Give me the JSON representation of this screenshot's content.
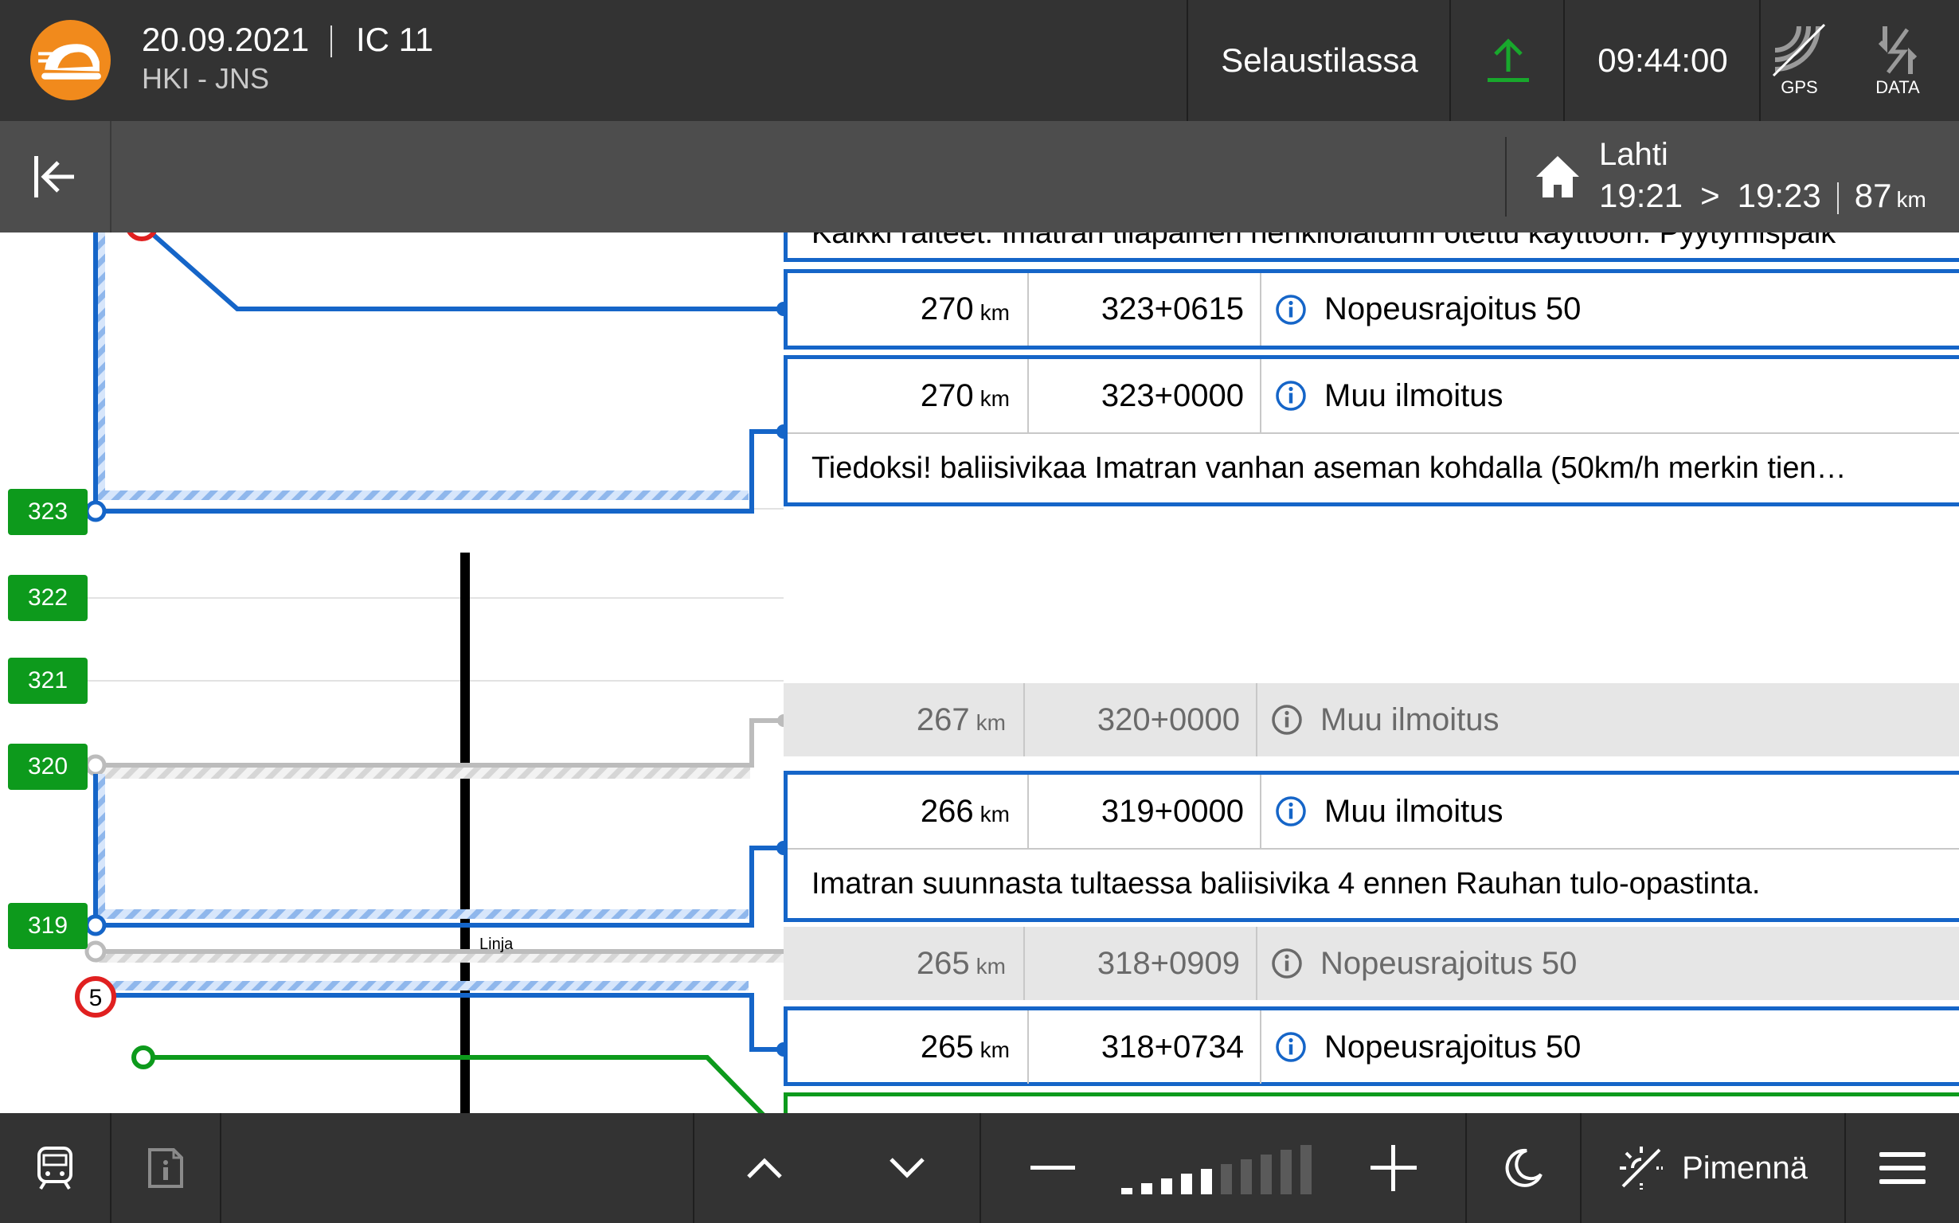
{
  "header": {
    "date": "20.09.2021",
    "train": "IC 11",
    "route": "HKI - JNS",
    "mode": "Selaustilassa",
    "clock": "09:44:00",
    "gps_label": "GPS",
    "data_label": "DATA",
    "upload_icon": "upload-arrow-icon",
    "colors": {
      "bar": "#333333",
      "upload": "#18a82c",
      "logo": "#f18a1c"
    }
  },
  "subheader": {
    "destination": "Lahti",
    "scheduled_time": "19:21",
    "arrow": ">",
    "estimated_time": "19:23",
    "distance": "87",
    "distance_unit": "km"
  },
  "track": {
    "badges": [
      "323",
      "322",
      "321",
      "320",
      "319"
    ],
    "speed_sign": "5",
    "linia_label": "Linja",
    "colors": {
      "active": "#1565c8",
      "inactive": "#bcbcbc",
      "green": "#0d9a1c",
      "speed_ring": "#e02020"
    }
  },
  "notices": {
    "top_partial_text": "Kaikki raiteet: Imatran tilapäinen henkilölaiturin otettu käyttöön. Pyytymispaik",
    "items": [
      {
        "km": "270",
        "unit": "km",
        "position": "323+0615",
        "title": "Nopeusrajoitus 50",
        "active": true
      },
      {
        "km": "270",
        "unit": "km",
        "position": "323+0000",
        "title": "Muu ilmoitus",
        "description": "Tiedoksi! baliisivikaa Imatran vanhan aseman kohdalla (50km/h merkin tien…",
        "active": true
      },
      {
        "km": "267",
        "unit": "km",
        "position": "320+0000",
        "title": "Muu ilmoitus",
        "active": false
      },
      {
        "km": "266",
        "unit": "km",
        "position": "319+0000",
        "title": "Muu ilmoitus",
        "description": "Imatran suunnasta tultaessa baliisivika 4 ennen Rauhan tulo-opastinta.",
        "active": true
      },
      {
        "km": "265",
        "unit": "km",
        "position": "318+0909",
        "title": "Nopeusrajoitus 50",
        "active": false
      },
      {
        "km": "265",
        "unit": "km",
        "position": "318+0734",
        "title": "Nopeusrajoitus 50",
        "active": true
      }
    ]
  },
  "footer": {
    "dim_label": "Pimennä",
    "zoom_level": 5,
    "zoom_max": 10,
    "icons": [
      "train-icon",
      "info-document-icon",
      "chevron-up-icon",
      "chevron-down-icon",
      "minus-icon",
      "plus-icon",
      "moon-icon",
      "dim-icon",
      "menu-icon"
    ]
  }
}
